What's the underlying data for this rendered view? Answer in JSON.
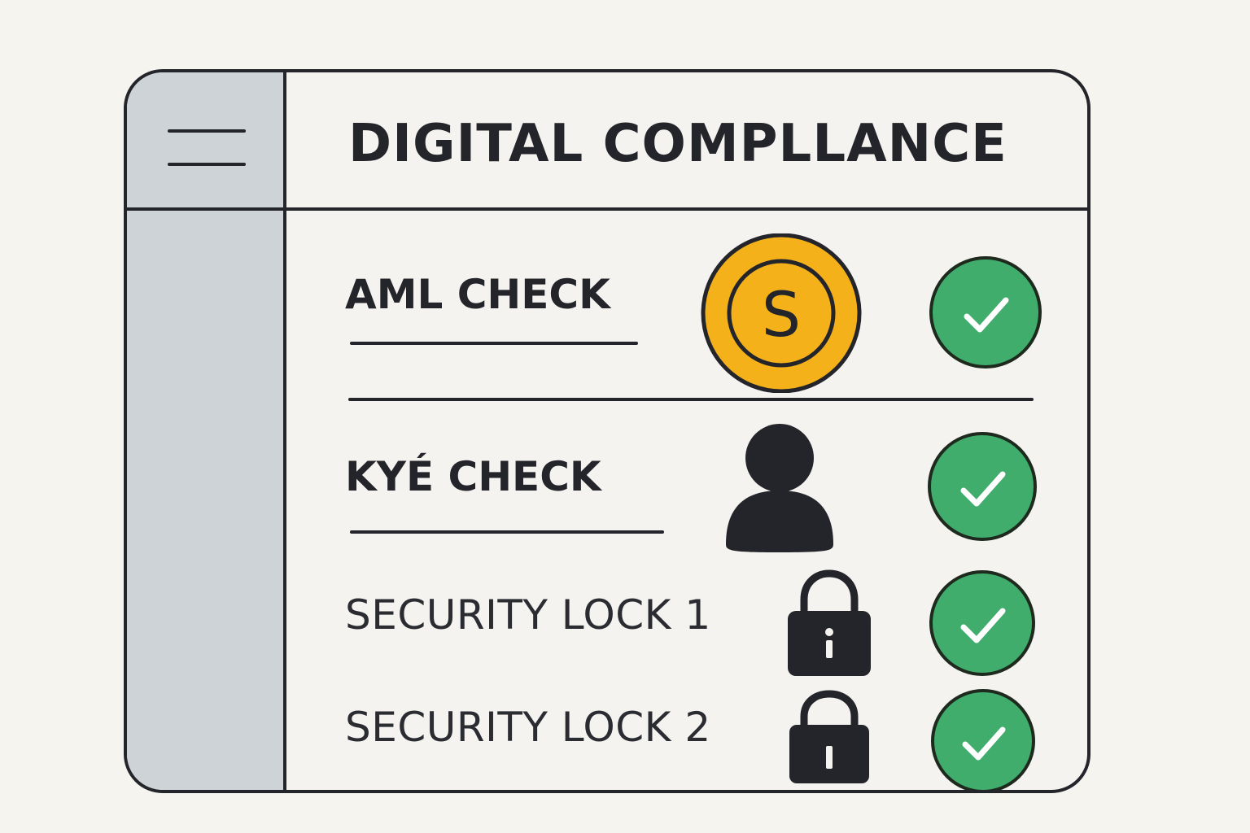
{
  "app": {
    "title": "DIGITAL COMPLLANCE"
  },
  "sidebar": {
    "menu_icon": "hamburger-menu-icon"
  },
  "checks": [
    {
      "label": "AML CHECK",
      "icon": "coin-dollar-icon",
      "status_icon": "check-circle-icon"
    },
    {
      "label": "KYÉ CHECK",
      "icon": "user-silhouette-icon",
      "status_icon": "check-circle-icon"
    },
    {
      "label": "SECURITY LOCK 1",
      "icon": "padlock-icon",
      "status_icon": "check-circle-icon"
    },
    {
      "label": "SECURITY LOCK 2",
      "icon": "padlock-icon",
      "status_icon": "check-circle-icon"
    }
  ],
  "colors": {
    "background": "#f6f4ef",
    "sidebar": "#cdd3d6",
    "outline": "#24252b",
    "coin": "#f5b11a",
    "check": "#40ad6d"
  }
}
